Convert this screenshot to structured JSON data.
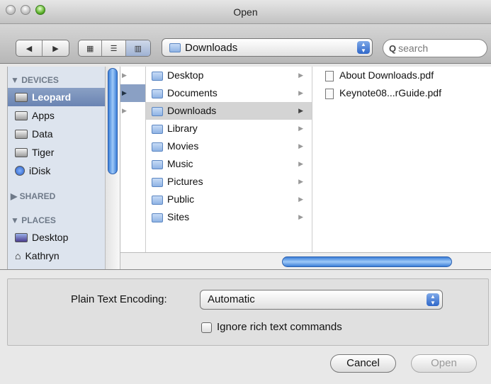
{
  "window": {
    "title": "Open"
  },
  "toolbar": {
    "back": "◀",
    "forward": "▶",
    "view_icons": "▦",
    "view_list": "☰",
    "view_columns": "▥",
    "location": "Downloads",
    "search_placeholder": "search"
  },
  "sidebar": {
    "devices_header": "▼ DEVICES",
    "devices": [
      "Leopard",
      "Apps",
      "Data",
      "Tiger",
      "iDisk"
    ],
    "shared_header": "▶ SHARED",
    "places_header": "▼ PLACES",
    "places": [
      "Desktop",
      "Kathryn"
    ]
  },
  "columns": {
    "home": [
      "Desktop",
      "Documents",
      "Downloads",
      "Library",
      "Movies",
      "Music",
      "Pictures",
      "Public",
      "Sites"
    ],
    "selected": "Downloads",
    "files": [
      "About Downloads.pdf",
      "Keynote08...rGuide.pdf"
    ]
  },
  "options": {
    "encoding_label": "Plain Text Encoding:",
    "encoding_value": "Automatic",
    "ignore_rich_label": "Ignore rich text commands",
    "ignore_rich_checked": false
  },
  "buttons": {
    "cancel": "Cancel",
    "open": "Open"
  }
}
